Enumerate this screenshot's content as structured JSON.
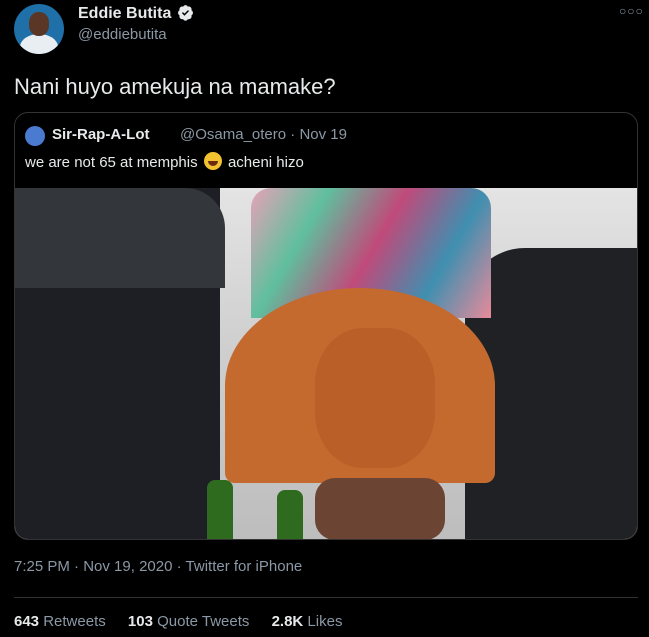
{
  "author": {
    "name": "Eddie Butita",
    "handle": "@eddiebutita"
  },
  "tweet": {
    "text": "Nani huyo amekuja na mamake?",
    "time": "7:25 PM",
    "date": "Nov 19, 2020",
    "source": "Twitter for iPhone",
    "separator": "·"
  },
  "quoted_tweet": {
    "name": "Sir-Rap-A-Lot",
    "handle": "@Osama_otero",
    "date": "Nov 19",
    "text_before_emoji": "we are not 65 at memphis",
    "emoji": "laugh-cry",
    "text_after_emoji": "acheni hizo"
  },
  "stats": {
    "retweets_count": "643",
    "retweets_label": "Retweets",
    "quote_tweets_count": "103",
    "quote_tweets_label": "Quote Tweets",
    "likes_count": "2.8K",
    "likes_label": "Likes"
  },
  "colors": {
    "background": "#000000",
    "verified_badge": "#e7e9ea",
    "secondary_text": "#8b98a5"
  }
}
